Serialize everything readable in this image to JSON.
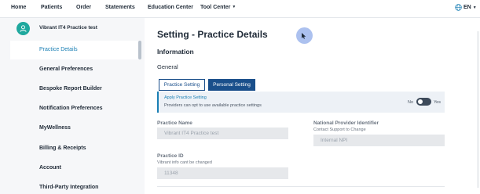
{
  "nav": {
    "items": [
      "Home",
      "Patients",
      "Order",
      "Statements",
      "Education Center",
      "Tool Center"
    ],
    "language": "EN"
  },
  "sidebar": {
    "brand": "Vibrant IT4 Practice test",
    "active_sub": "Practice Details",
    "items": [
      "General Preferences",
      "Bespoke Report Builder",
      "Notification Preferences",
      "MyWellness",
      "Billing & Receipts",
      "Account",
      "Third-Party Integration"
    ]
  },
  "main": {
    "title": "Setting - Practice Details",
    "section": "Information",
    "subsection": "General",
    "tabs": [
      "Practice Setting",
      "Personal Setting"
    ],
    "active_tab": "Personal Setting",
    "apply": {
      "title": "Apply Practice Setting",
      "description": "Providers can opt to use available practice settings",
      "no_label": "No",
      "yes_label": "Yes",
      "state": "No"
    },
    "fields": {
      "practice_name": {
        "label": "Practice Name",
        "value": "Vibrant IT4 Practice test"
      },
      "npi": {
        "label": "National Provider Identifier",
        "hint": "Contact Support to Change",
        "value": "Internal NPI"
      },
      "practice_id": {
        "label": "Practice ID",
        "hint": "Vibrant info cant be changed",
        "value": "11348"
      }
    }
  },
  "colors": {
    "accent": "#1a4f8b",
    "link": "#1a7fb4",
    "avatar": "#1fa89e"
  }
}
